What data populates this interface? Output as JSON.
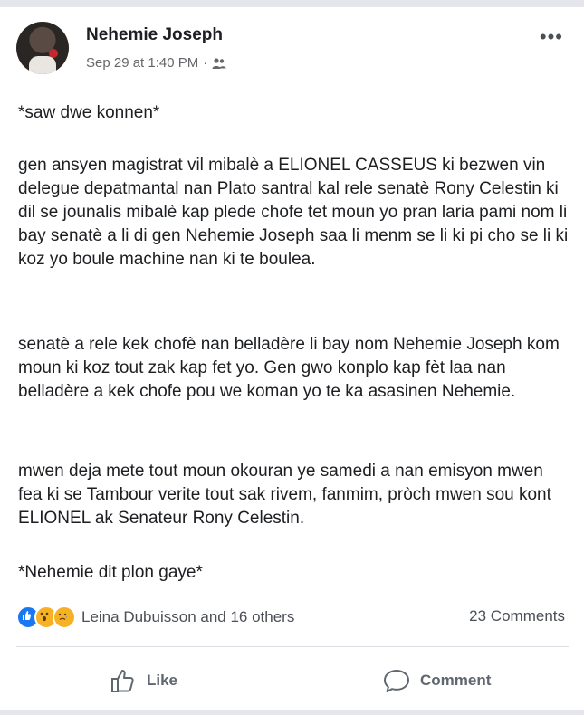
{
  "post": {
    "author": "Nehemie Joseph",
    "timestamp": "Sep 29 at 1:40 PM",
    "separator": "·",
    "audience_icon": "friends-icon",
    "more_icon": "three-dots-icon",
    "paragraphs": [
      "*saw dwe konnen*",
      "gen ansyen magistrat vil mibalè a ELIONEL CASSEUS ki bezwen vin delegue depatmantal nan Plato santral kal rele senatè Rony Celestin ki dil se jounalis mibalè kap plede chofe tet moun yo pran laria pami nom li bay senatè a li di gen Nehemie Joseph saa li menm se li ki pi cho se li ki koz yo boule machine nan ki te boulea.",
      "senatè a rele kek chofè nan belladère li bay nom Nehemie Joseph kom moun ki koz tout zak kap fet yo. Gen gwo konplo kap fèt laa nan belladère a kek chofe pou we koman yo te ka asasinen Nehemie.",
      "mwen deja mete tout moun okouran ye samedi a nan emisyon mwen fea ki se Tambour verite tout sak rivem, fanmim, pròch mwen sou kont ELIONEL ak Senateur Rony Celestin.",
      "*Nehemie dit plon gaye*"
    ]
  },
  "reactions": {
    "icons": [
      "like-reaction-icon",
      "wow-reaction-icon",
      "sad-reaction-icon"
    ],
    "label": "Leina Dubuisson and 16 others",
    "comments": "23 Comments"
  },
  "actions": {
    "like_label": "Like",
    "comment_label": "Comment"
  },
  "colors": {
    "like_blue": "#1877f2",
    "reaction_yellow": "#f7b125",
    "secondary_text": "#65676b"
  }
}
